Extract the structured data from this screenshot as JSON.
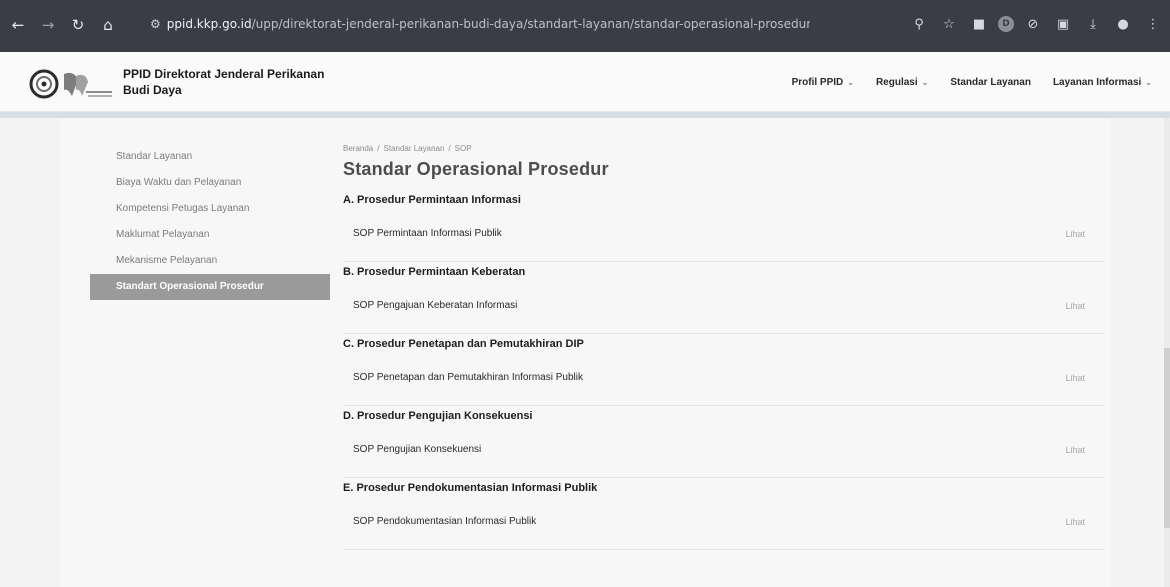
{
  "browser": {
    "url_host": "ppid.kkp.go.id",
    "url_path": "/upp/direktorat-jenderal-perikanan-budi-daya/standart-layanan/standar-operasional-prosedur/",
    "profile_initial": "D"
  },
  "header": {
    "brand_line1": "PPID Direktorat Jenderal Perikanan",
    "brand_line2": "Budi Daya",
    "nav": [
      {
        "label": "Profil PPID",
        "dropdown": true
      },
      {
        "label": "Regulasi",
        "dropdown": true
      },
      {
        "label": "Standar Layanan",
        "dropdown": false
      },
      {
        "label": "Layanan Informasi",
        "dropdown": true
      }
    ]
  },
  "sidebar": {
    "items": [
      {
        "label": "Standar Layanan"
      },
      {
        "label": "Biaya Waktu dan Pelayanan"
      },
      {
        "label": "Kompetensi Petugas Layanan"
      },
      {
        "label": "Maklumat Pelayanan"
      },
      {
        "label": "Mekanisme Pelayanan"
      },
      {
        "label": "Standart Operasional Prosedur"
      }
    ]
  },
  "breadcrumb": [
    "Beranda",
    "Standar Layanan",
    "SOP"
  ],
  "page": {
    "title": "Standar Operasional Prosedur",
    "link_label": "Lihat",
    "sections": [
      {
        "title": "A. Prosedur Permintaan Informasi",
        "item": "SOP Permintaan Informasi Publik"
      },
      {
        "title": "B. Prosedur Permintaan Keberatan",
        "item": "SOP Pengajuan Keberatan Informasi"
      },
      {
        "title": "C. Prosedur Penetapan dan Pemutakhiran DIP",
        "item": "SOP Penetapan dan Pemutakhiran Informasi Publik"
      },
      {
        "title": "D. Prosedur Pengujian Konsekuensi",
        "item": "SOP Pengujian Konsekuensi"
      },
      {
        "title": "E. Prosedur Pendokumentasian Informasi Publik",
        "item": "SOP Pendokumentasian Informasi Publik"
      }
    ]
  }
}
